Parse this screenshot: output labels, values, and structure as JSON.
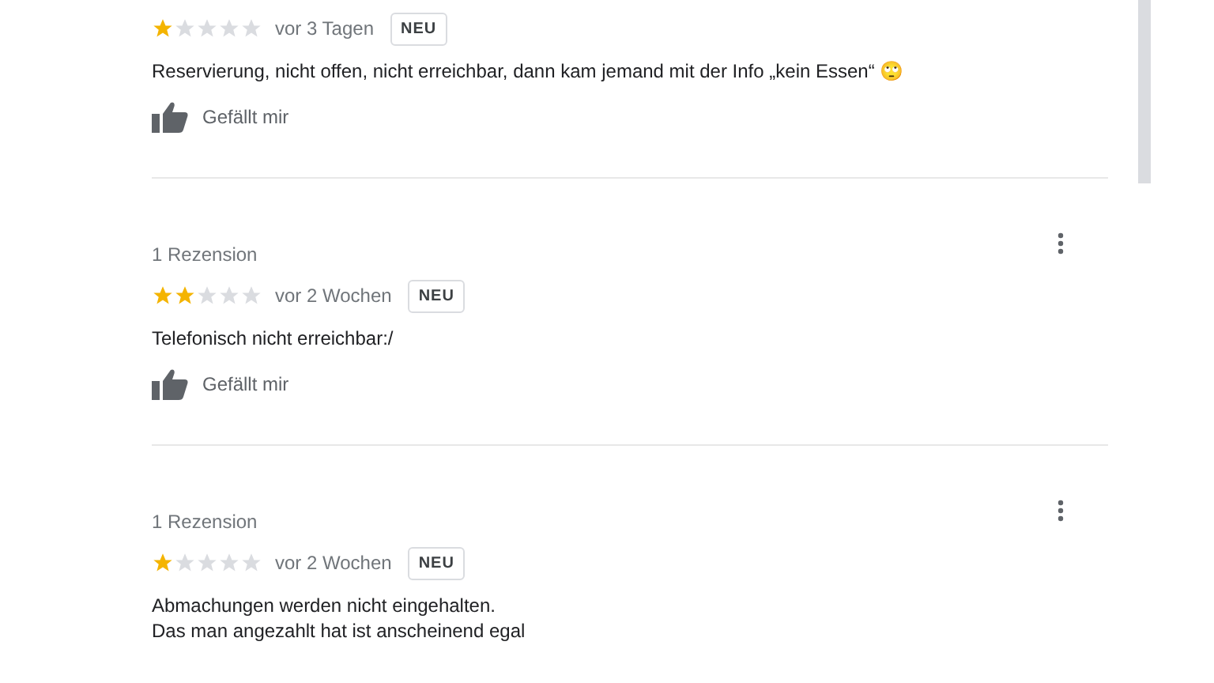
{
  "reviews": [
    {
      "has_menu": false,
      "stars": 1,
      "time": "vor 3 Tagen",
      "badge": "NEU",
      "text": "Reservierung, nicht offen, nicht erreichbar, dann kam jemand mit der Info „kein Essen“ 🙄",
      "like": "Gefällt mir"
    },
    {
      "header": "1 Rezension",
      "has_menu": true,
      "stars": 2,
      "time": "vor 2 Wochen",
      "badge": "NEU",
      "text": "Telefonisch nicht erreichbar:/",
      "like": "Gefällt mir"
    },
    {
      "header": "1 Rezension",
      "has_menu": true,
      "stars": 1,
      "time": "vor 2 Wochen",
      "badge": "NEU",
      "text": "Abmachungen werden nicht eingehalten.\nDas man angezahlt hat ist anscheinend egal"
    }
  ]
}
